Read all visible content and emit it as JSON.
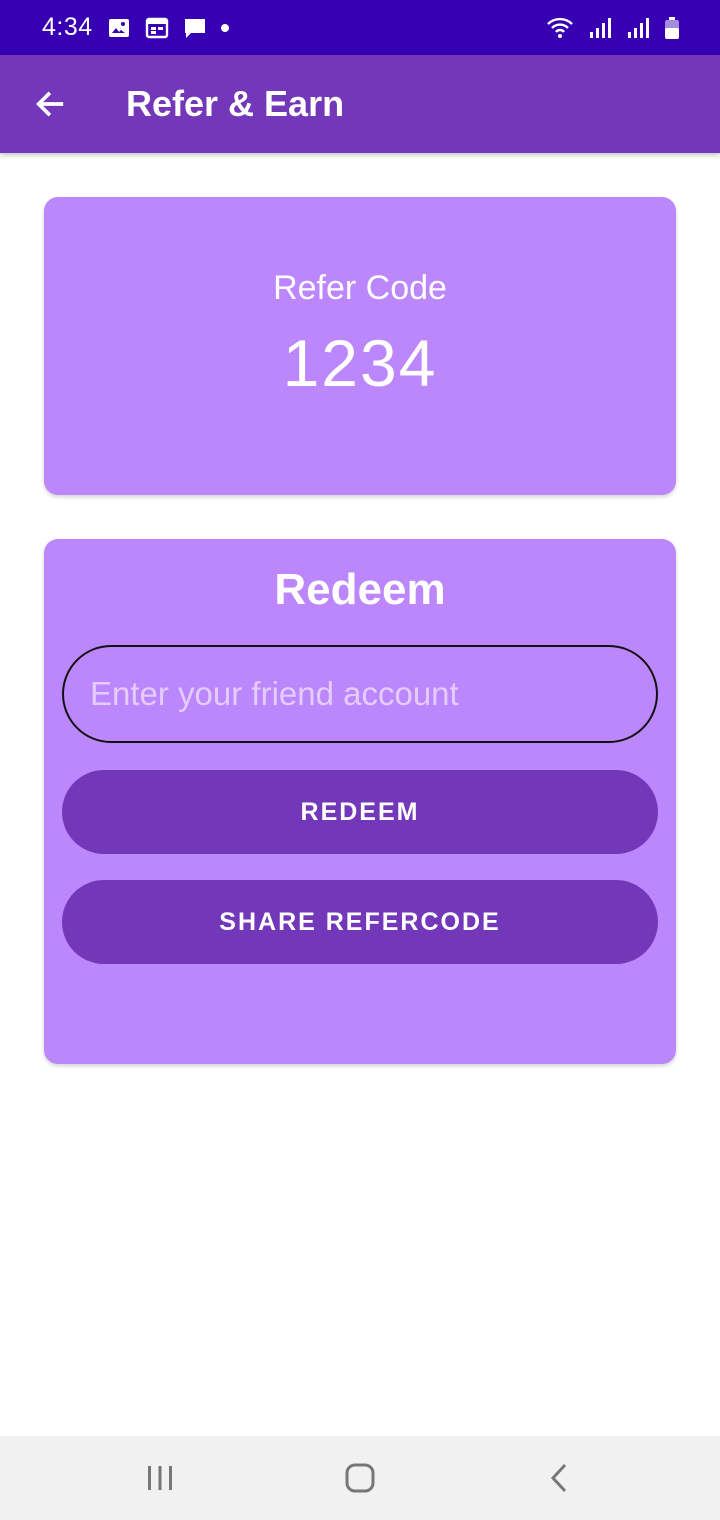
{
  "status_bar": {
    "time": "4:34",
    "left_icons": [
      "image-icon",
      "calendar-icon",
      "message-icon",
      "dot-icon"
    ],
    "right_icons": [
      "wifi-icon",
      "signal-icon",
      "signal-icon",
      "battery-icon"
    ]
  },
  "app_bar": {
    "title": "Refer & Earn",
    "back_icon": "arrow-back-icon"
  },
  "refer_card": {
    "label": "Refer Code",
    "code": "1234"
  },
  "redeem_card": {
    "title": "Redeem",
    "input_placeholder": "Enter your friend account",
    "input_value": "",
    "redeem_label": "REDEEM",
    "share_label": "SHARE REFERCODE"
  },
  "nav_bar": {
    "icons": [
      "recents-icon",
      "home-icon",
      "back-icon"
    ]
  },
  "colors": {
    "status_bar": "#3700b3",
    "app_bar": "#7338b9",
    "card": "#bc86fc",
    "button": "#7338b9"
  }
}
